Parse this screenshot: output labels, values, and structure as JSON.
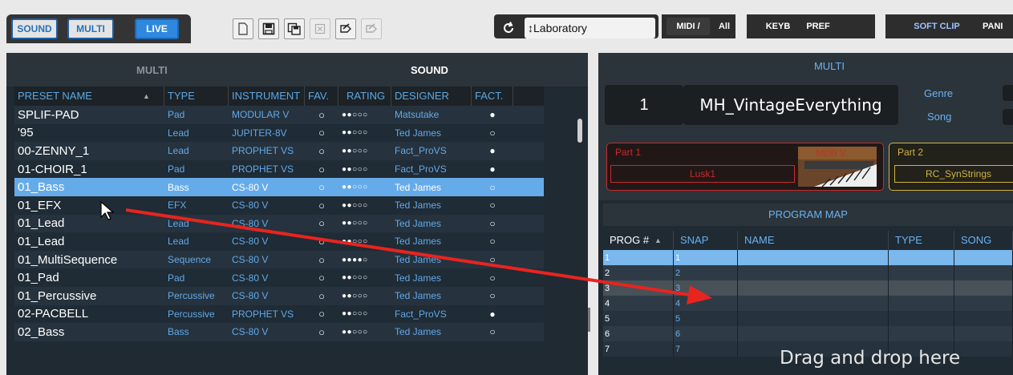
{
  "toolbar": {
    "modes": [
      {
        "label": "SOUND",
        "active": false
      },
      {
        "label": "MULTI",
        "active": false
      },
      {
        "label": "LIVE",
        "active": true
      }
    ],
    "icons": [
      "new-file-icon",
      "save-icon",
      "save-as-icon",
      "delete-icon",
      "import-icon",
      "export-icon"
    ],
    "refresh_icon": "refresh-icon",
    "preset_selector": "↕Laboratory",
    "midi_label": "MIDI /",
    "all_label": "All",
    "keyb_label": "KEYB",
    "pref_label": "PREF",
    "softclip_label": "SOFT CLIP",
    "panic_label": "PANI"
  },
  "browser": {
    "tab_multi": "MULTI",
    "tab_sound": "SOUND",
    "columns": [
      "PRESET NAME",
      "TYPE",
      "INSTRUMENT",
      "FAV.",
      "RATING",
      "DESIGNER",
      "FACT."
    ],
    "rows": [
      {
        "name": " SPLIF-PAD",
        "type": "Pad",
        "instrument": "MODULAR V",
        "fav": "○",
        "rating": "●●○○○",
        "designer": "Matsutake",
        "fact": "●"
      },
      {
        "name": "'95",
        "type": "Lead",
        "instrument": "JUPITER-8V",
        "fav": "○",
        "rating": "●●○○○",
        "designer": "Ted James",
        "fact": "○"
      },
      {
        "name": "00-ZENNY_1",
        "type": "Lead",
        "instrument": "PROPHET VS",
        "fav": "○",
        "rating": "●●○○○",
        "designer": "Fact_ProVS",
        "fact": "●"
      },
      {
        "name": "01-CHOIR_1",
        "type": "Pad",
        "instrument": "PROPHET VS",
        "fav": "○",
        "rating": "●●○○○",
        "designer": "Fact_ProVS",
        "fact": "●"
      },
      {
        "name": "01_Bass",
        "type": "Bass",
        "instrument": "CS-80 V",
        "fav": "○",
        "rating": "●●○○○",
        "designer": "Ted James",
        "fact": "○",
        "selected": true
      },
      {
        "name": "01_EFX",
        "type": "EFX",
        "instrument": "CS-80 V",
        "fav": "○",
        "rating": "●●○○○",
        "designer": "Ted James",
        "fact": "○"
      },
      {
        "name": "01_Lead",
        "type": "Lead",
        "instrument": "CS-80 V",
        "fav": "○",
        "rating": "●●○○○",
        "designer": "Ted James",
        "fact": "○"
      },
      {
        "name": "01_Lead",
        "type": "Lead",
        "instrument": "CS-80 V",
        "fav": "○",
        "rating": "●●○○○",
        "designer": "Ted James",
        "fact": "○"
      },
      {
        "name": "01_MultiSequence",
        "type": "Sequence",
        "instrument": "CS-80 V",
        "fav": "○",
        "rating": "●●●●○",
        "designer": "Ted James",
        "fact": "○"
      },
      {
        "name": "01_Pad",
        "type": "Pad",
        "instrument": "CS-80 V",
        "fav": "○",
        "rating": "●●○○○",
        "designer": "Ted James",
        "fact": "○"
      },
      {
        "name": "01_Percussive",
        "type": "Percussive",
        "instrument": "CS-80 V",
        "fav": "○",
        "rating": "●●○○○",
        "designer": "Ted James",
        "fact": "○"
      },
      {
        "name": "02-PACBELL",
        "type": "Percussive",
        "instrument": "PROPHET VS",
        "fav": "○",
        "rating": "●●○○○",
        "designer": "Fact_ProVS",
        "fact": "●"
      },
      {
        "name": "02_Bass",
        "type": "Bass",
        "instrument": "CS-80 V",
        "fav": "○",
        "rating": "●●○○○",
        "designer": "Ted James",
        "fact": "○"
      }
    ]
  },
  "multi": {
    "title": "MULTI",
    "number": "1",
    "name": "MH_VintageEverything",
    "genre_label": "Genre",
    "song_label": "Song",
    "part1": {
      "label": "Part 1",
      "value": "Lusk1",
      "thumb_text": "MINI V"
    },
    "part2": {
      "label": "Part 2",
      "value": "RC_SynStrings"
    }
  },
  "program_map": {
    "title": "PROGRAM MAP",
    "columns": [
      "PROG #",
      "SNAP",
      "NAME",
      "TYPE",
      "SONG"
    ],
    "rows": [
      {
        "prog": "1",
        "snap": "1",
        "selected": true
      },
      {
        "prog": "2",
        "snap": "2"
      },
      {
        "prog": "3",
        "snap": "3",
        "highlight": true
      },
      {
        "prog": "4",
        "snap": "4"
      },
      {
        "prog": "5",
        "snap": "5"
      },
      {
        "prog": "6",
        "snap": "6"
      },
      {
        "prog": "7",
        "snap": "7"
      }
    ],
    "drop_hint": "Drag and drop here"
  },
  "colors": {
    "accent": "#2f88de",
    "arrow": "#e8241f",
    "part1": "#c92a2a",
    "part2": "#d2b43e"
  }
}
